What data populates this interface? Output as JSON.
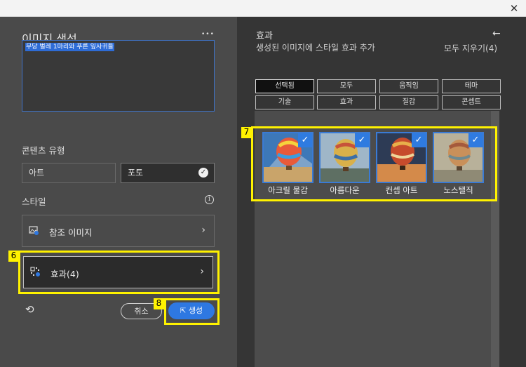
{
  "titlebar": {
    "close_icon": "✕"
  },
  "left": {
    "title": "이미지 생성",
    "more_icon": "•••",
    "prompt_text": "무당 벌레 1마리와 푸른 잎사귀들",
    "content_type_label": "콘텐츠 유형",
    "content_types": [
      "아트",
      "포토"
    ],
    "selected_content_type": "포토",
    "style_label": "스타일",
    "info_icon": "i",
    "reference_image_label": "참조 이미지",
    "effects_label": "효과(4)",
    "chevron": "›",
    "undo_icon": "⟲",
    "cancel_label": "취소",
    "generate_label": "생성"
  },
  "right": {
    "title": "효과",
    "subtitle": "생성된 이미지에 스타일 효과 추가",
    "back_icon": "←",
    "clear_all_label": "모두 지우기(4)",
    "chips": [
      "선택됨",
      "모두",
      "움직임",
      "테마",
      "기술",
      "효과",
      "질감",
      "콘셉트"
    ],
    "selected_chip": "선택됨",
    "effects": [
      {
        "label": "아크릴 물감",
        "checked": true
      },
      {
        "label": "아름다운",
        "checked": true
      },
      {
        "label": "컨셉 아트",
        "checked": true
      },
      {
        "label": "노스탤직",
        "checked": true
      }
    ],
    "check_mark": "✓"
  },
  "annotations": {
    "tag6": "6",
    "tag7": "7",
    "tag8": "8"
  },
  "colors": {
    "accent": "#2e78e2",
    "highlight": "#fff200"
  }
}
